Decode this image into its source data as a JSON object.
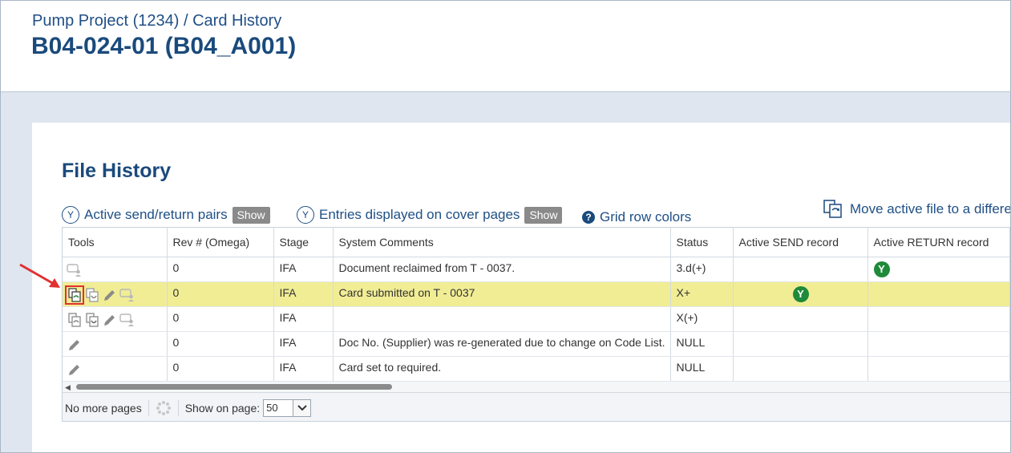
{
  "header": {
    "breadcrumb": "Pump Project (1234) / Card History",
    "title": "B04-024-01 (B04_A001)"
  },
  "section": {
    "title": "File History"
  },
  "legend": {
    "pairs_label": "Active send/return pairs",
    "pairs_badge": "Y",
    "pairs_button": "Show",
    "cover_label": "Entries displayed on cover pages",
    "cover_badge": "Y",
    "cover_button": "Show",
    "grid_colors_label": "Grid row colors",
    "move_label": "Move active file to a differe"
  },
  "table": {
    "columns": [
      "Tools",
      "Rev # (Omega)",
      "Stage",
      "System Comments",
      "Status",
      "Active SEND record",
      "Active RETURN record"
    ],
    "rows": [
      {
        "rev": "0",
        "stage": "IFA",
        "comment": "Document reclaimed from T - 0037.",
        "status": "3.d(+)",
        "send": "",
        "return": "Y",
        "tools": [
          "comment-user-icon"
        ],
        "highlight": false
      },
      {
        "rev": "0",
        "stage": "IFA",
        "comment": "Card submitted on T - 0037",
        "status": "X+",
        "send": "Y",
        "return": "",
        "tools": [
          "copy-file-icon",
          "return-file-icon",
          "pencil-icon",
          "comment-user-icon"
        ],
        "highlight": true
      },
      {
        "rev": "0",
        "stage": "IFA",
        "comment": "",
        "status": "X(+)",
        "send": "",
        "return": "",
        "tools": [
          "copy-file-icon",
          "return-file-icon",
          "pencil-icon",
          "comment-user-icon"
        ],
        "highlight": false
      },
      {
        "rev": "0",
        "stage": "IFA",
        "comment": "Doc No. (Supplier) was re-generated due to change on Code List.",
        "status": "NULL",
        "send": "",
        "return": "",
        "tools": [
          "pencil-icon"
        ],
        "highlight": false
      },
      {
        "rev": "0",
        "stage": "IFA",
        "comment": "Card set to required.",
        "status": "NULL",
        "send": "",
        "return": "",
        "tools": [
          "pencil-icon"
        ],
        "highlight": false
      }
    ]
  },
  "pager": {
    "no_more_pages": "No more pages",
    "show_on_page_label": "Show on page:",
    "page_size": "50"
  },
  "colors": {
    "title": "#1a4a7c",
    "highlight_row": "#f1ed95",
    "badge_green": "#1e8a3a",
    "annotation_red": "#e03131"
  }
}
